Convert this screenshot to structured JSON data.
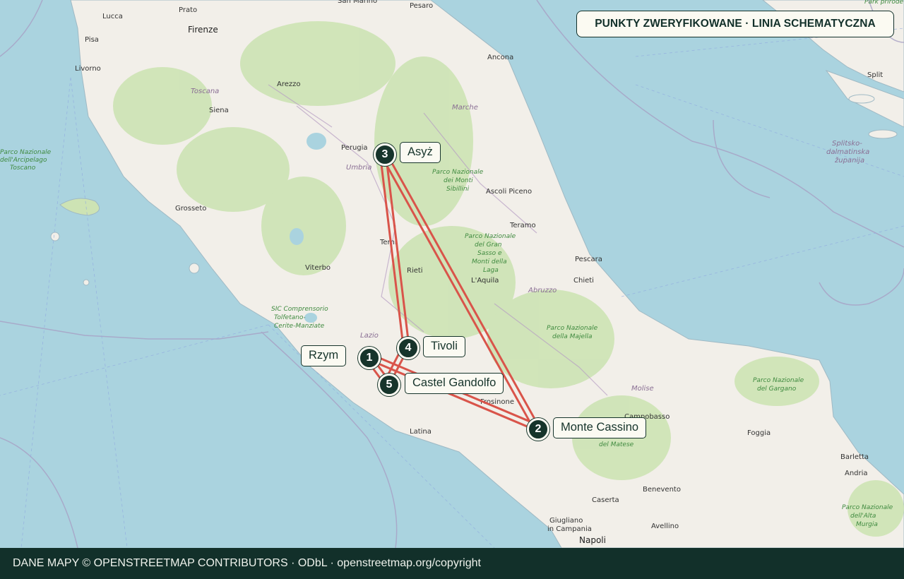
{
  "badge": {
    "text": "PUNKTY ZWERYFIKOWANE · LINIA SCHEMATYCZNA"
  },
  "stops": [
    {
      "number": "1",
      "name": "Rzym"
    },
    {
      "number": "2",
      "name": "Monte Cassino"
    },
    {
      "number": "3",
      "name": "Asyż"
    },
    {
      "number": "4",
      "name": "Tivoli"
    },
    {
      "number": "5",
      "name": "Castel Gandolfo"
    }
  ],
  "route": {
    "order": [
      "1",
      "2",
      "3",
      "4",
      "5",
      "1"
    ],
    "color": "#d9544a"
  },
  "basemap": {
    "cities": [
      "Lucca",
      "Prato",
      "Firenze",
      "Pesaro",
      "San Marino",
      "Livorno",
      "Pisa",
      "Arezzo",
      "Siena",
      "Ancona",
      "Perugia",
      "Grosseto",
      "Ascoli Piceno",
      "Teramo",
      "Terni",
      "Rieti",
      "Viterbo",
      "L'Aquila",
      "Pescara",
      "Chieti",
      "Latina",
      "Frosinone",
      "Campobasso",
      "Foggia",
      "Benevento",
      "Caserta",
      "Giugliano in Campania",
      "Napoli",
      "Avellino",
      "Barletta",
      "Andria",
      "Split"
    ],
    "regions": [
      "Toscana",
      "Marche",
      "Umbria",
      "Lazio",
      "Abruzzo",
      "Molise",
      "Splitsko-dalmatinska županija",
      "Županija"
    ],
    "parks": [
      "Parco Nazionale dell'Arcipelago Toscano",
      "Parco Nazionale dei Monti Sibillini",
      "Parco Nazionale del Gran Sasso e Monti della Laga",
      "Parco Nazionale della Majella",
      "Parco Nazionale del Gargano",
      "Parco Nazionale dell'Alta Murgia",
      "SIC Comprensorio Tolfetano-Cerite-Manziate",
      "Park prirode",
      "del Matese"
    ]
  },
  "colors": {
    "sea": "#aad3df",
    "land": "#f2efe9",
    "forest": "#cde3b4",
    "accent": "#16342b"
  },
  "footer": {
    "text": "DANE MAPY © OPENSTREETMAP CONTRIBUTORS · ODbL · openstreetmap.org/copyright"
  }
}
